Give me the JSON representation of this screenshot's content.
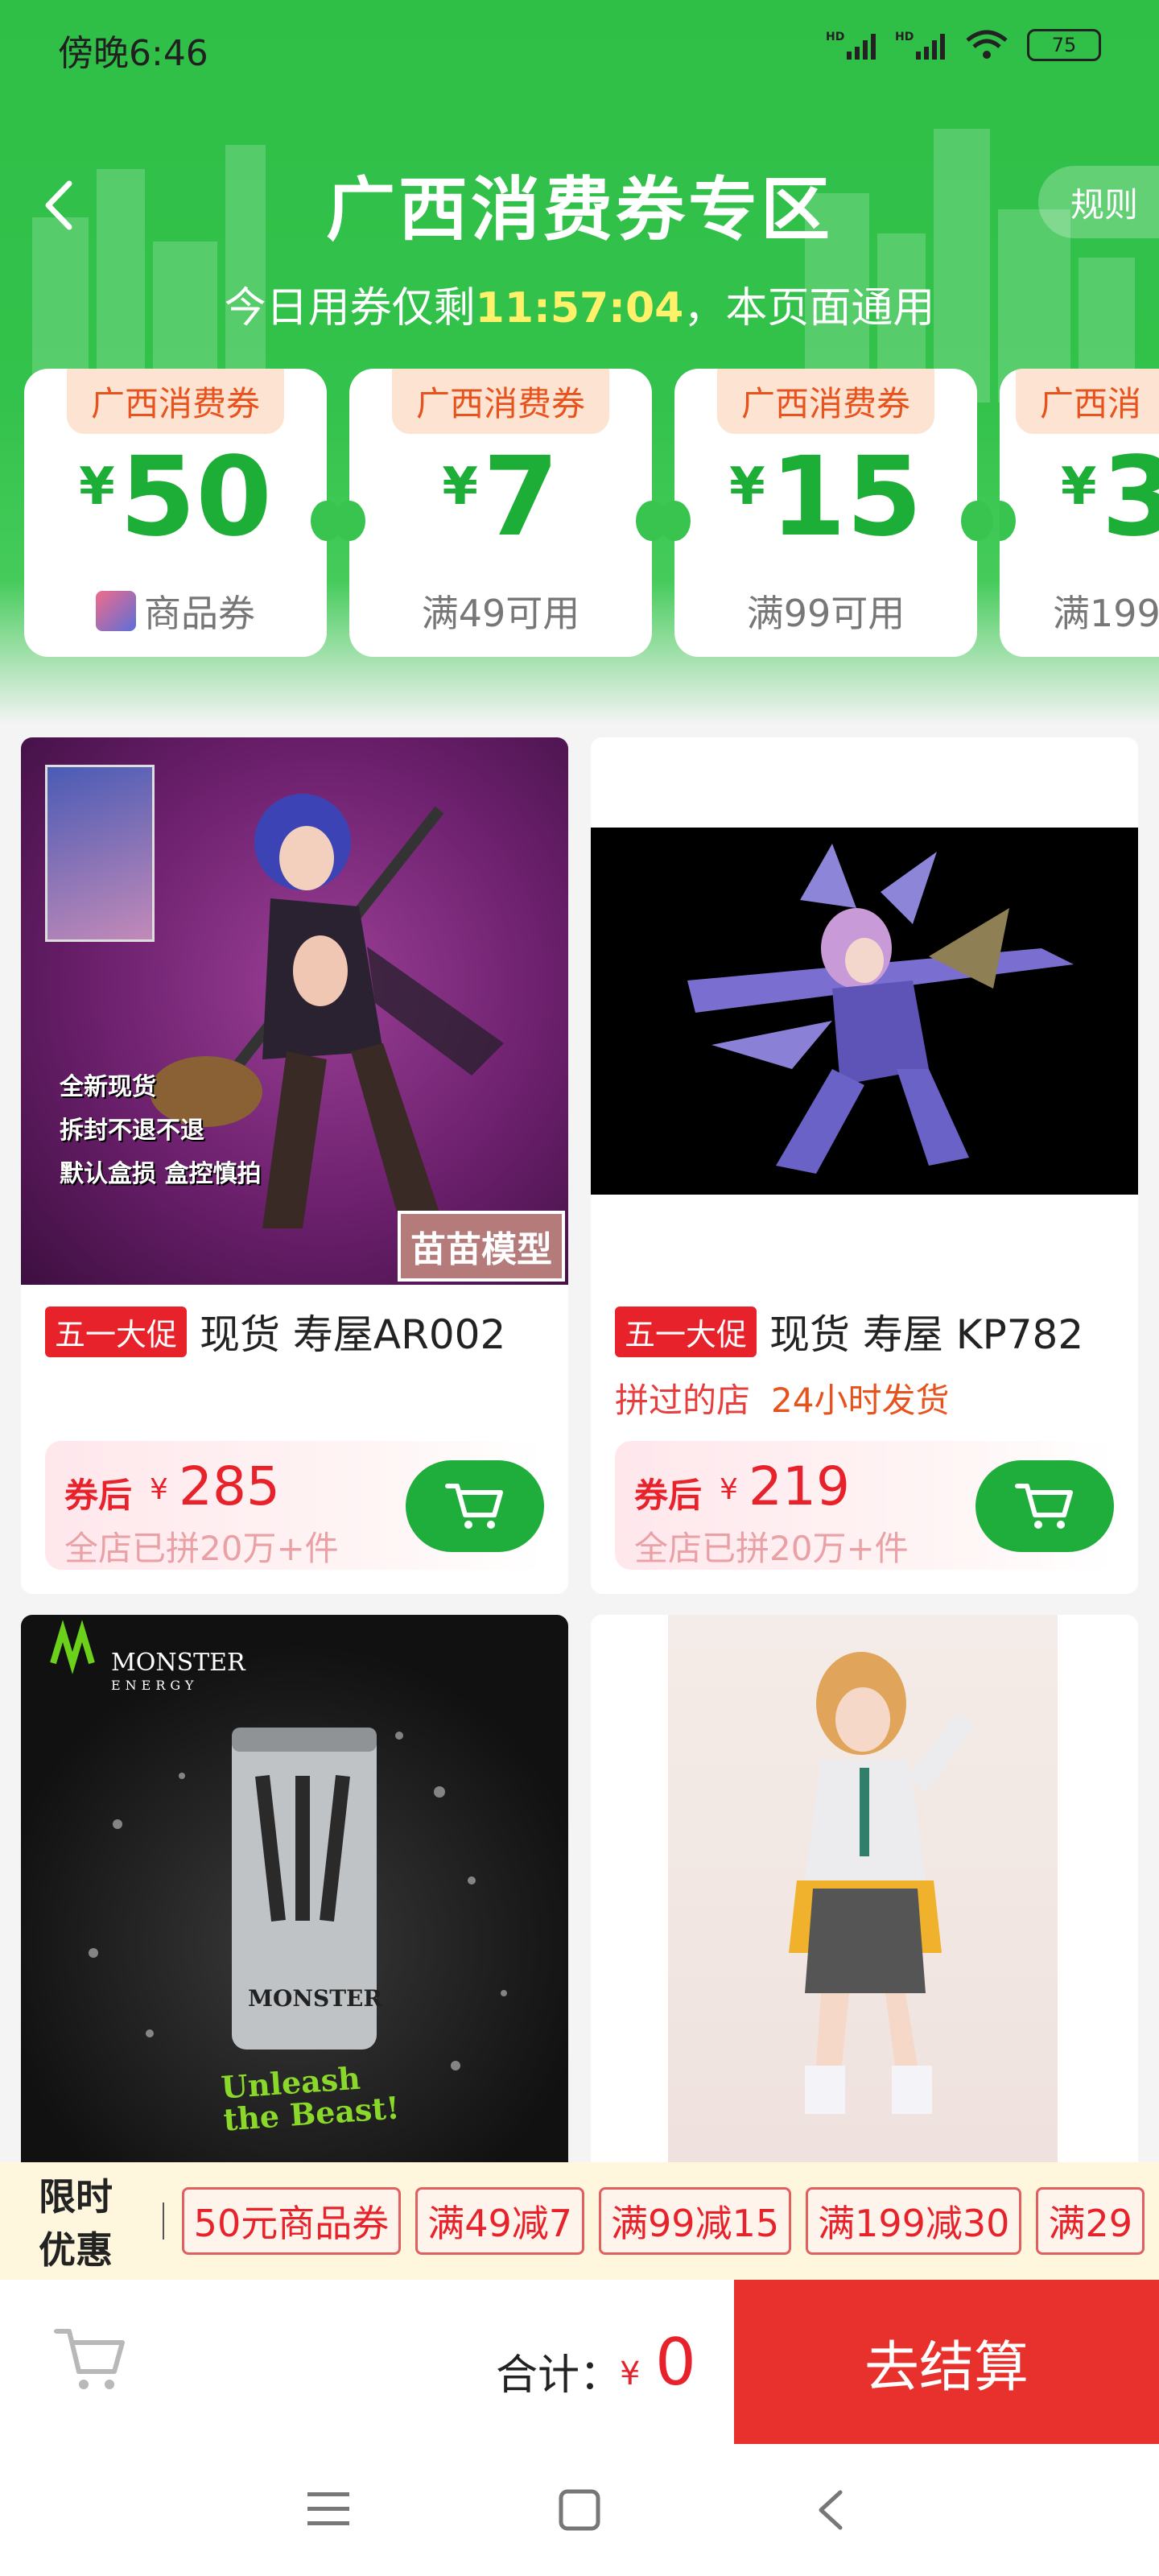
{
  "status_bar": {
    "time": "傍晚6:46",
    "battery": "75"
  },
  "header": {
    "title": "广西消费券专区",
    "rules_label": "规则",
    "subtitle_prefix": "今日用券仅剩",
    "countdown": "11:57:04",
    "subtitle_suffix": "，本页面通用"
  },
  "coupons": [
    {
      "tag": "广西消费券",
      "currency": "¥",
      "amount": "50",
      "condition": "商品券"
    },
    {
      "tag": "广西消费券",
      "currency": "¥",
      "amount": "7",
      "condition": "满49可用"
    },
    {
      "tag": "广西消费券",
      "currency": "¥",
      "amount": "15",
      "condition": "满99可用"
    },
    {
      "tag": "广西消",
      "currency": "¥",
      "amount": "3",
      "condition": "满199"
    }
  ],
  "products": [
    {
      "promo": "五一大促",
      "title": "现货 寿屋AR002",
      "image_text": [
        "全新现货",
        "拆封不退不退",
        "默认盒损 盒控慎拍"
      ],
      "brand_stamp": "苗苗模型",
      "price_label": "券后",
      "currency": "¥",
      "price": "285",
      "sold": "全店已拼20万+件"
    },
    {
      "promo": "五一大促",
      "title": "现货 寿屋 KP782",
      "shop_tags": [
        "拼过的店",
        "24小时发货"
      ],
      "price_label": "券后",
      "currency": "¥",
      "price": "219",
      "sold": "全店已拼20万+件"
    },
    {
      "image_text": [
        "MONSTER",
        "ENERGY",
        "MONSTER",
        "Unleash",
        "the Beast!"
      ]
    },
    {}
  ],
  "promo_strip": {
    "title": "限时优惠",
    "chips": [
      "50元商品券",
      "满49减7",
      "满99减15",
      "满199减30",
      "满29"
    ]
  },
  "bottom_bar": {
    "total_label": "合计：",
    "currency": "¥",
    "total": "0",
    "checkout": "去结算"
  },
  "colors": {
    "brand_green": "#33c24b",
    "cta_red": "#e8312c",
    "price_red": "#e8222b",
    "countdown_yellow": "#fff26a"
  }
}
